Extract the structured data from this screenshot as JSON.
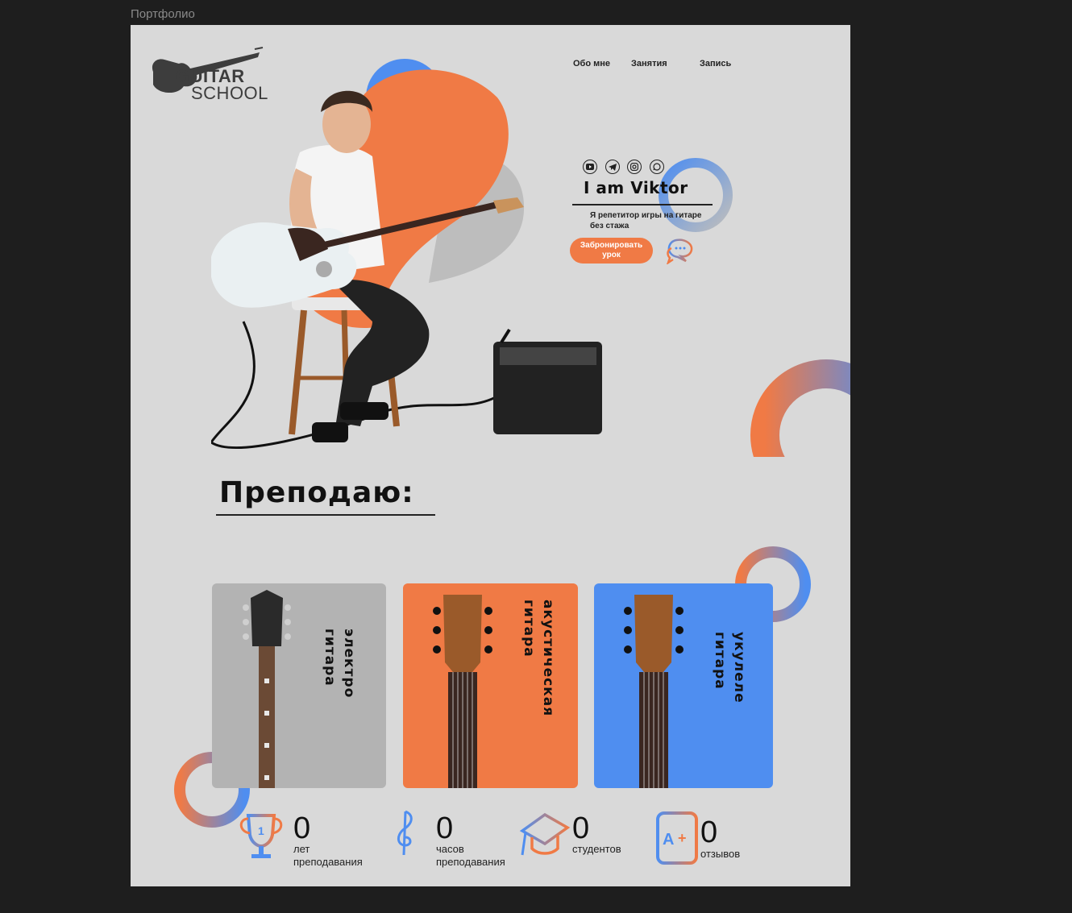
{
  "frame_label": "Портфолио",
  "logo": {
    "line1": "GUITAR",
    "line2": "SCHOOL"
  },
  "nav": [
    {
      "label": "Обо мне"
    },
    {
      "label": "Занятия"
    },
    {
      "label": "Запись"
    }
  ],
  "hero": {
    "socials": [
      "youtube-icon",
      "telegram-icon",
      "instagram-icon",
      "whatsapp-icon"
    ],
    "title": "I am Viktor",
    "subtitle_line1": "Я репетитор игры на гитаре",
    "subtitle_line2": "без стажа",
    "book_button": "Забронировать урок"
  },
  "teach": {
    "title": "Преподаю:",
    "cards": [
      {
        "line1": "электро",
        "line2": "гитара",
        "color": "#b3b3b3"
      },
      {
        "line1": "акустическая",
        "line2": "гитара",
        "color": "#f07a45"
      },
      {
        "line1": "укулеле",
        "line2": "гитара",
        "color": "#4f8ef0"
      }
    ]
  },
  "stats": [
    {
      "value": "0",
      "line1": "лет",
      "line2": "преподавания",
      "icon": "trophy-icon"
    },
    {
      "value": "0",
      "line1": "часов",
      "line2": "преподавания",
      "icon": "music-note-icon"
    },
    {
      "value": "0",
      "line1": "студентов",
      "line2": "",
      "icon": "graduation-cap-icon"
    },
    {
      "value": "0",
      "line1": "отзывов",
      "line2": "",
      "icon": "grade-a-plus-icon"
    }
  ],
  "colors": {
    "accent_orange": "#f07a45",
    "accent_blue": "#4f8ef0",
    "canvas_bg": "#d9d9d9"
  }
}
